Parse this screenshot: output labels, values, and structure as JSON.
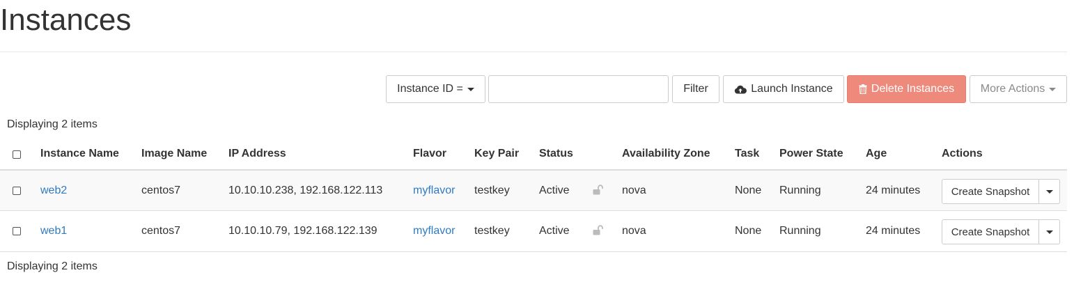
{
  "page": {
    "title": "Instances"
  },
  "toolbar": {
    "filter_field_label": "Instance ID =",
    "filter_input_value": "",
    "filter_label": "Filter",
    "launch_label": "Launch Instance",
    "delete_label": "Delete Instances",
    "more_label": "More Actions"
  },
  "table": {
    "count_text": "Displaying 2 items",
    "headers": {
      "name": "Instance Name",
      "image": "Image Name",
      "ip": "IP Address",
      "flavor": "Flavor",
      "keypair": "Key Pair",
      "status": "Status",
      "az": "Availability Zone",
      "task": "Task",
      "power": "Power State",
      "age": "Age",
      "actions": "Actions"
    },
    "rows": [
      {
        "name": "web2",
        "image": "centos7",
        "ip": "10.10.10.238, 192.168.122.113",
        "flavor": "myflavor",
        "keypair": "testkey",
        "status": "Active",
        "status_icon": "unlock-icon",
        "az": "nova",
        "task": "None",
        "power": "Running",
        "age": "24 minutes",
        "action": "Create Snapshot"
      },
      {
        "name": "web1",
        "image": "centos7",
        "ip": "10.10.10.79, 192.168.122.139",
        "flavor": "myflavor",
        "keypair": "testkey",
        "status": "Active",
        "status_icon": "unlock-icon",
        "az": "nova",
        "task": "None",
        "power": "Running",
        "age": "24 minutes",
        "action": "Create Snapshot"
      }
    ]
  },
  "colors": {
    "link": "#2f7ac2",
    "danger": "#ee8a7c",
    "row_stripe": "#f9f9f9"
  }
}
